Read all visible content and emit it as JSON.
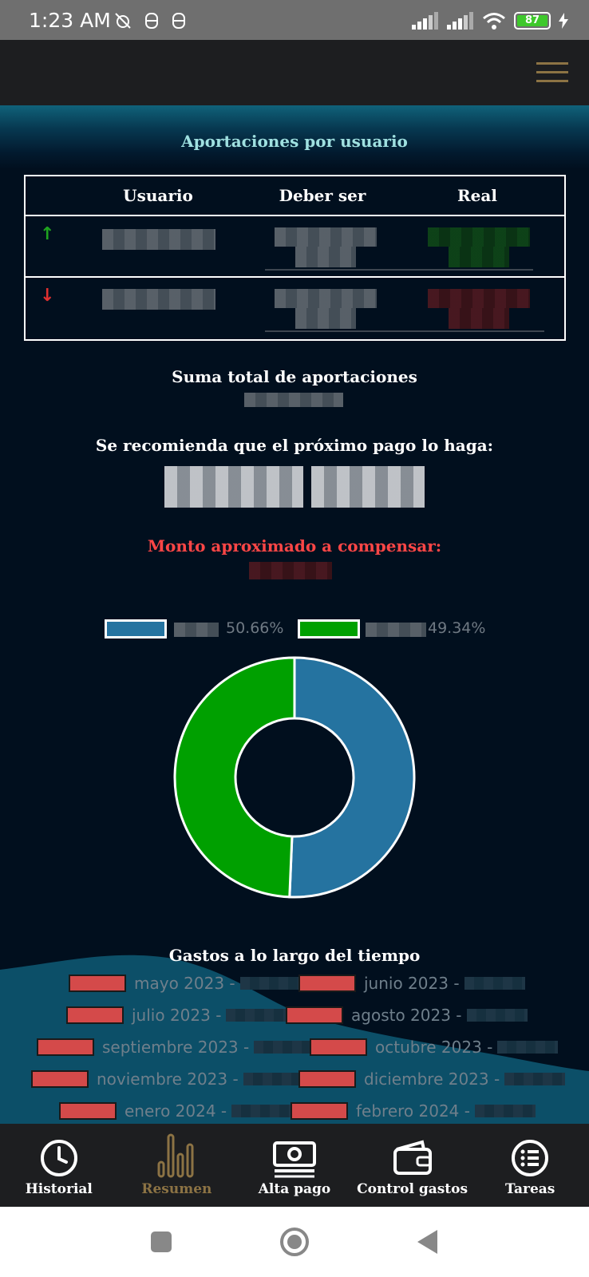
{
  "status_bar": {
    "time": "1:23 AM",
    "battery": "87"
  },
  "contributions": {
    "title": "Aportaciones por usuario",
    "columns": [
      "Usuario",
      "Deber ser",
      "Real"
    ],
    "rows": [
      {
        "trend": "↑",
        "trend_color": "#1fa31f"
      },
      {
        "trend": "↓",
        "trend_color": "#e03030"
      }
    ]
  },
  "summary": {
    "total_label": "Suma total de aportaciones",
    "recommend_label": "Se recomienda que el próximo pago lo haga:",
    "compensate_label": "Monto aproximado a compensar:"
  },
  "chart_data": {
    "type": "pie",
    "series": [
      {
        "value": 50.66,
        "label": "50.66%",
        "color": "#2573a0"
      },
      {
        "value": 49.34,
        "label": "49.34%",
        "color": "#00a000"
      }
    ]
  },
  "timeline": {
    "title": "Gastos a lo largo del tiempo",
    "months": [
      "mayo 2023 -",
      "junio 2023 -",
      "julio 2023 -",
      "agosto 2023 -",
      "septiembre 2023 -",
      "octubre 2023 -",
      "noviembre 2023 -",
      "diciembre 2023 -",
      "enero 2024 -",
      "febrero 2024 -"
    ]
  },
  "nav": [
    {
      "label": "Historial",
      "icon": "clock-icon"
    },
    {
      "label": "Resumen",
      "icon": "bar-chart-icon",
      "active": true
    },
    {
      "label": "Alta pago",
      "icon": "money-icon"
    },
    {
      "label": "Control gastos",
      "icon": "wallet-icon"
    },
    {
      "label": "Tareas",
      "icon": "list-icon"
    }
  ]
}
